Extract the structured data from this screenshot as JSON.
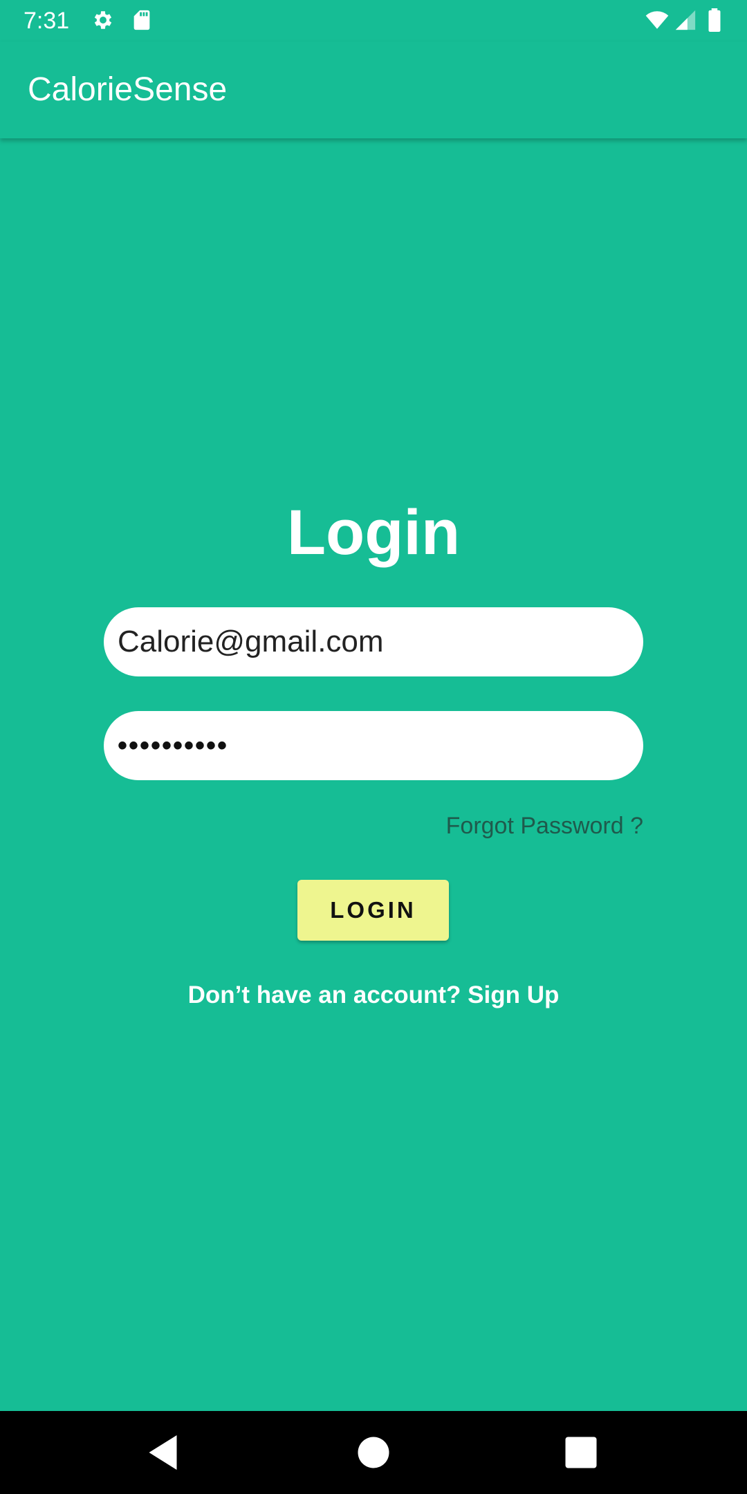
{
  "status_bar": {
    "time": "7:31",
    "icons": [
      "gear-icon",
      "sd-card-icon",
      "wifi-icon",
      "cell-signal-icon",
      "battery-icon"
    ]
  },
  "app_bar": {
    "title": "CalorieSense"
  },
  "login": {
    "heading": "Login",
    "email_value": "Calorie@gmail.com",
    "password_masked": "••••••••••",
    "forgot_password": "Forgot Password ?",
    "login_button": "LOGIN",
    "signup_prompt": "Don’t have an account? Sign Up"
  },
  "nav_bar": {
    "icons": [
      "back-icon",
      "home-icon",
      "recents-icon"
    ]
  },
  "colors": {
    "background": "#16BD95",
    "button": "#EEF58F",
    "nav_bar": "#000000"
  }
}
